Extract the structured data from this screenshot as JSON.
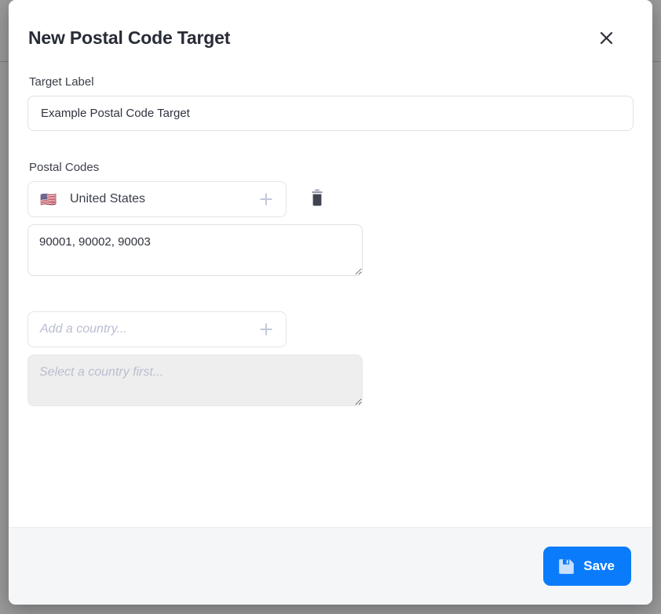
{
  "backdrop": {
    "color": "#9b9b9b"
  },
  "dialog": {
    "title": "New Postal Code Target",
    "close_label": "×",
    "accent_color": "#0a7cfb"
  },
  "form": {
    "target_label": {
      "label": "Target Label",
      "value": "Example Postal Code Target",
      "placeholder": "Target Label"
    },
    "postal_codes": {
      "label": "Postal Codes",
      "entries": [
        {
          "flag": "🇺🇸",
          "country": "United States",
          "codes": "90001, 90002, 90003",
          "add_icon": "plus-icon",
          "delete_icon": "trash-icon"
        }
      ],
      "new_entry": {
        "country_placeholder": "Add a country...",
        "codes_placeholder": "Select a country first...",
        "add_icon": "plus-icon"
      }
    }
  },
  "footer": {
    "save_label": "Save",
    "save_icon": "floppy-disk-icon"
  }
}
